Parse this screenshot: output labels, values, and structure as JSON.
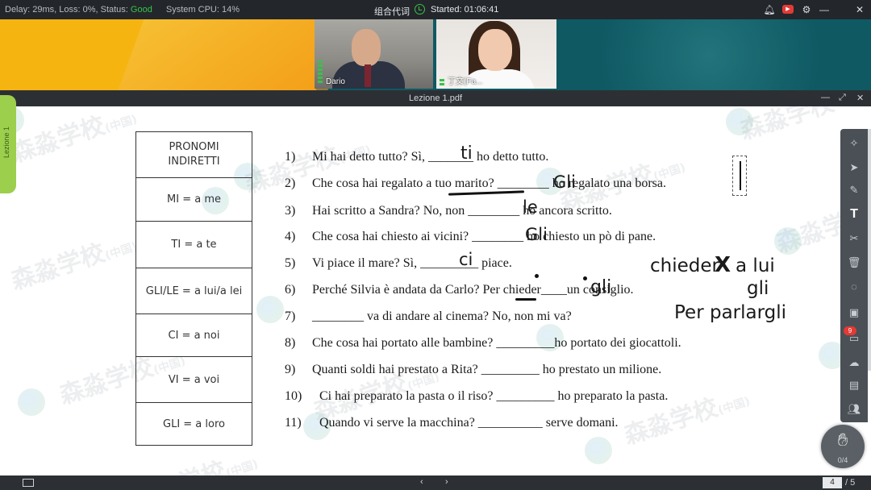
{
  "status_bar": {
    "delay_text": "Delay: 29ms, Loss: 0%, Status:",
    "status_value": "Good",
    "cpu_text": "System CPU: 14%",
    "combo_words": "组合代词",
    "started": "Started: 01:06:41",
    "icons": [
      "bell-icon",
      "youtube-icon",
      "gear-icon",
      "minimize-icon",
      "close-icon"
    ],
    "colors": {
      "good": "#38c24a",
      "bar": "#23272b"
    }
  },
  "video": {
    "teacher_name": "Dario",
    "student_name": "丁文(Fa..."
  },
  "document": {
    "title": "Lezione 1.pdf",
    "side_tab": "Lezione 1",
    "watermark": "森淼学校",
    "watermark_suffix": "(中国)"
  },
  "pronouns": {
    "header": "PRONOMI INDIRETTI",
    "rows": [
      "MI = a me",
      "TI = a te",
      "GLI/LE = a lui/a lei",
      "CI = a noi",
      "VI = a voi",
      "GLI = a loro"
    ]
  },
  "exercises": [
    {
      "num": "1)",
      "text": "Mi hai detto tutto? Sì, _______ ho detto tutto."
    },
    {
      "num": "2)",
      "text": "Che cosa hai regalato a tuo marito? ________ ho regalato una borsa."
    },
    {
      "num": "3)",
      "text": "Hai scritto a Sandra? No, non ________ ho ancora scritto."
    },
    {
      "num": "4)",
      "text": "Che cosa hai chiesto ai vicini? ________ ho chiesto un pò di pane."
    },
    {
      "num": "5)",
      "text": "Vi piace il mare? Sì, _________ piace."
    },
    {
      "num": "6)",
      "text": "Perché Silvia è andata da Carlo? Per chieder____un consiglio."
    },
    {
      "num": "7)",
      "text": "________ va di andare al cinema? No, non mi va?"
    },
    {
      "num": "8)",
      "text": "Che cosa hai portato alle bambine? _________ho portato dei giocattoli."
    },
    {
      "num": "9)",
      "text": "Quanti soldi hai prestato a Rita? _________ ho prestato un milione."
    },
    {
      "num": "10)",
      "text": "Ci hai preparato la pasta o il riso? _________ ho preparato la pasta."
    },
    {
      "num": "11)",
      "text": "Quando vi serve la macchina? __________ serve domani."
    }
  ],
  "handwriting": {
    "a1": "ti",
    "a2": "Gli",
    "a3": "le",
    "a4": "Gli",
    "a5": "ci",
    "a6": "gli",
    "note1_left": "chieder",
    "note1_mark": "X",
    "note1_right": "a lui",
    "note2": "gli",
    "note3": "Per parlargli"
  },
  "toolbar": {
    "tools": [
      "laser-pointer-icon",
      "select-arrow-icon",
      "pen-icon",
      "text-tool-icon",
      "scissors-icon",
      "trash-icon",
      "shape-icon",
      "gallery-icon",
      "chat-icon",
      "cloud-icon",
      "toolbox-icon",
      "users-icon"
    ],
    "chat_badge": "9",
    "hand_count": "0/4"
  },
  "pager": {
    "current": "4",
    "total": "/ 5"
  }
}
